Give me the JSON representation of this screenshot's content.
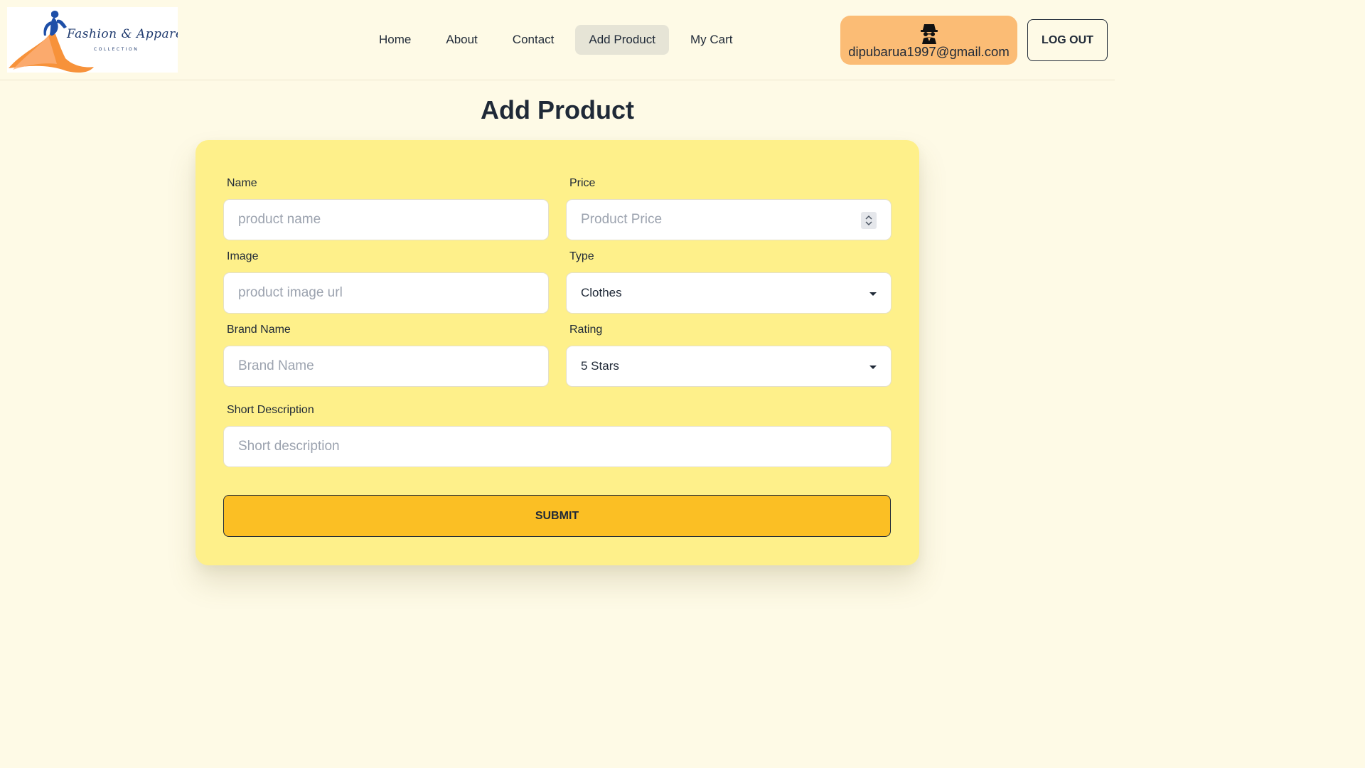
{
  "brand": {
    "name": "Fashion & Apparel",
    "sub": "COLLECTION"
  },
  "nav": {
    "links": [
      "Home",
      "About",
      "Contact",
      "Add Product",
      "My Cart"
    ],
    "active": "Add Product"
  },
  "user": {
    "email": "dipubarua1997@gmail.com",
    "icon": "spy-icon"
  },
  "logout_label": "LOG OUT",
  "page": {
    "title": "Add Product"
  },
  "form": {
    "name": {
      "label": "Name",
      "placeholder": "product name"
    },
    "price": {
      "label": "Price",
      "placeholder": "Product Price"
    },
    "image": {
      "label": "Image",
      "placeholder": "product image url"
    },
    "type": {
      "label": "Type",
      "value": "Clothes"
    },
    "brand_name": {
      "label": "Brand Name",
      "placeholder": "Brand Name"
    },
    "rating": {
      "label": "Rating",
      "value": "5 Stars"
    },
    "short_description": {
      "label": "Short Description",
      "placeholder": "Short description"
    },
    "submit_label": "SUBMIT"
  },
  "colors": {
    "page_bg": "#fefae6",
    "card_bg": "#fef08a",
    "user_pill": "#fbbc75",
    "submit_bg": "#fbbf24",
    "active_nav": "#e6e4d6"
  }
}
